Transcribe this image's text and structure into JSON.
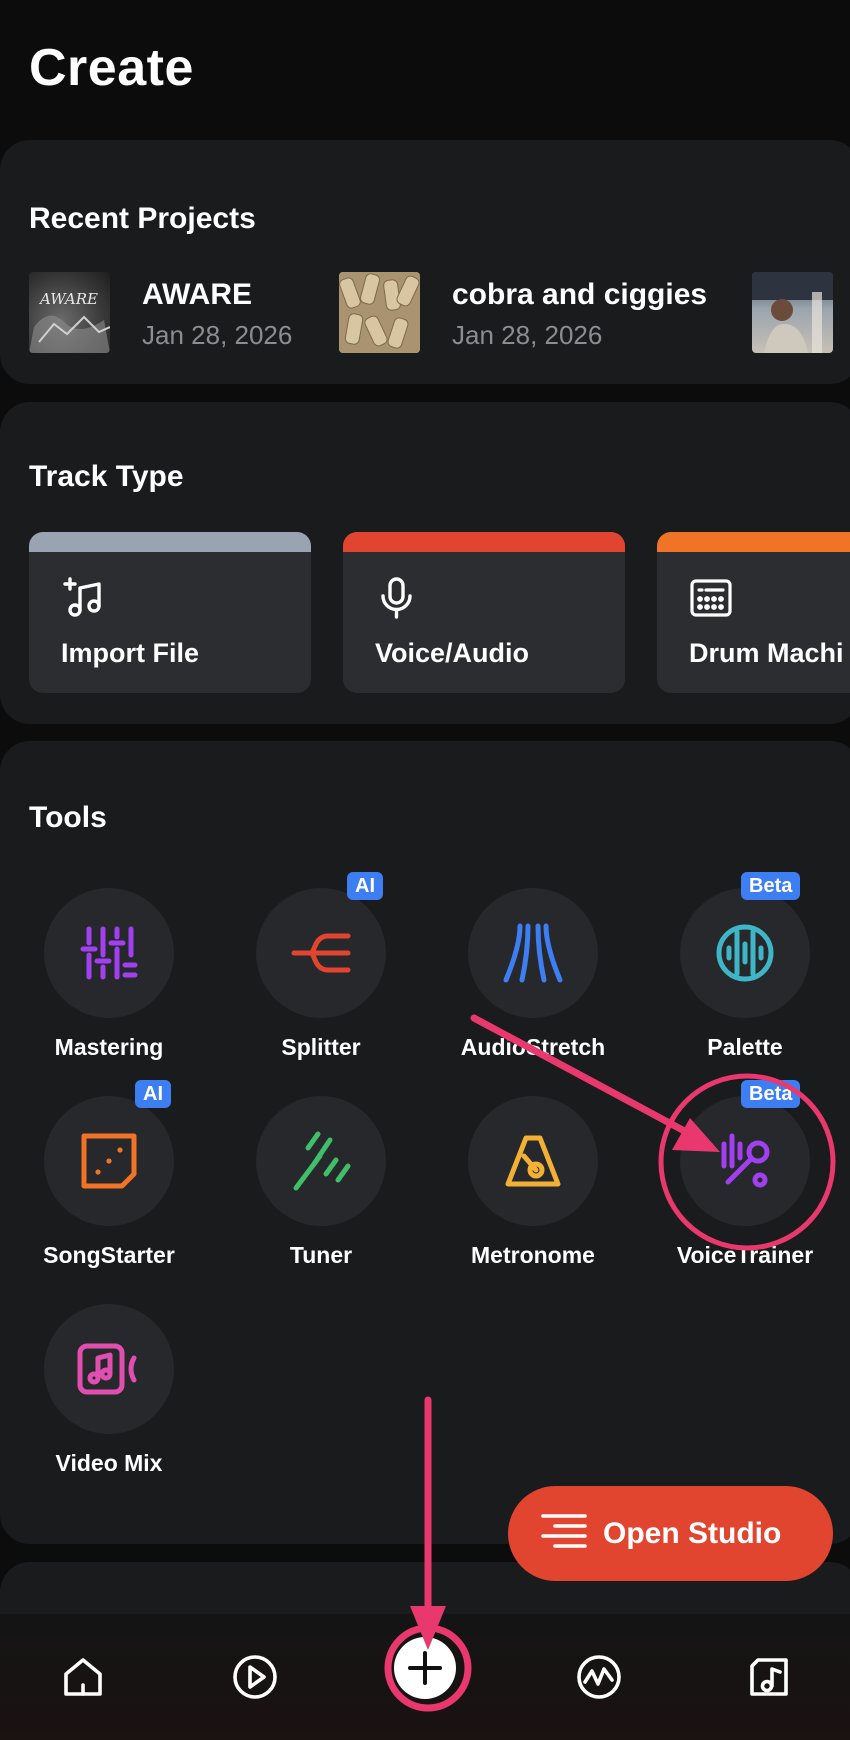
{
  "header": {
    "title": "Create"
  },
  "recent": {
    "title": "Recent Projects",
    "items": [
      {
        "name": "AWARE",
        "date": "Jan 28, 2026",
        "thumb_text": "AWARE"
      },
      {
        "name": "cobra and ciggies",
        "date": "Jan 28, 2026"
      },
      {
        "name": "",
        "date": ""
      }
    ]
  },
  "track_type": {
    "title": "Track Type",
    "items": [
      {
        "label": "Import File",
        "color": "#9aa3b1",
        "icon": "import-file-icon"
      },
      {
        "label": "Voice/Audio",
        "color": "#e2452f",
        "icon": "microphone-icon"
      },
      {
        "label": "Drum Machi",
        "color": "#f07326",
        "icon": "drum-machine-icon"
      }
    ]
  },
  "tools": {
    "title": "Tools",
    "items": [
      {
        "label": "Mastering",
        "color": "#a23ff0",
        "icon": "mastering-icon",
        "badge": ""
      },
      {
        "label": "Splitter",
        "color": "#e2452f",
        "icon": "splitter-icon",
        "badge": "AI"
      },
      {
        "label": "AudioStretch",
        "color": "#3d7ef3",
        "icon": "audiostretch-icon",
        "badge": ""
      },
      {
        "label": "Palette",
        "color": "#3fb6c5",
        "icon": "palette-icon",
        "badge": "Beta"
      },
      {
        "label": "SongStarter",
        "color": "#f07326",
        "icon": "songstarter-icon",
        "badge": "AI"
      },
      {
        "label": "Tuner",
        "color": "#3fbf6a",
        "icon": "tuner-icon",
        "badge": ""
      },
      {
        "label": "Metronome",
        "color": "#f2b134",
        "icon": "metronome-icon",
        "badge": ""
      },
      {
        "label": "VoiceTrainer",
        "color": "#a23ff0",
        "icon": "voicetrainer-icon",
        "badge": "Beta"
      },
      {
        "label": "Video Mix",
        "color": "#e04fb0",
        "icon": "video-mix-icon",
        "badge": ""
      }
    ]
  },
  "open_studio": {
    "label": "Open Studio",
    "color": "#e2452f"
  },
  "bottom_nav": [
    "home-icon",
    "play-icon",
    "plus-icon",
    "activity-icon",
    "library-icon"
  ],
  "annotation_color": "#e8386e"
}
